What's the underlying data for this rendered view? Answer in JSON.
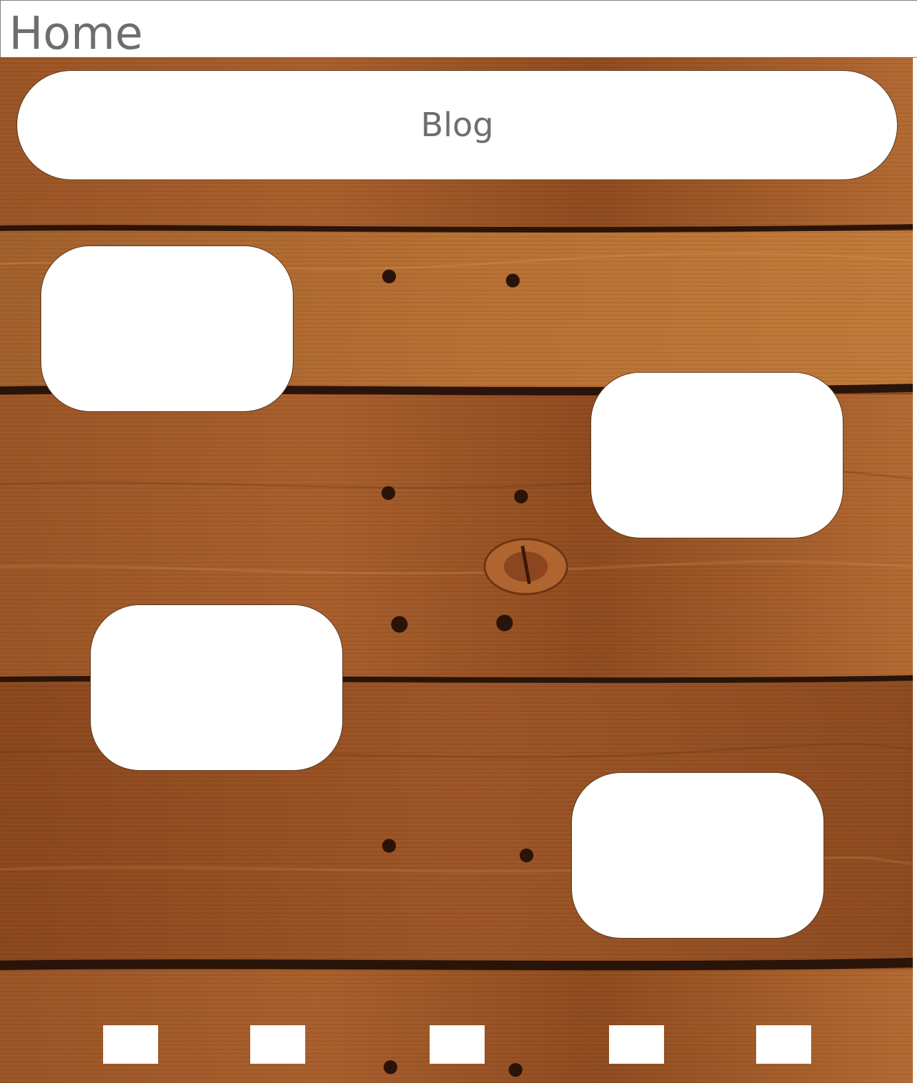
{
  "header": {
    "title": "Home"
  },
  "main": {
    "blog_button_label": "Blog",
    "cards": [
      {
        "label": ""
      },
      {
        "label": ""
      },
      {
        "label": ""
      },
      {
        "label": ""
      }
    ]
  },
  "pagination": {
    "items": [
      "",
      "",
      "",
      "",
      ""
    ]
  },
  "background": {
    "type": "wood-planks",
    "wood_base_color": "#8f4e22",
    "wood_light_color": "#b56c33",
    "gap_color": "#2a140a",
    "title_color": "#6e6e6e"
  }
}
